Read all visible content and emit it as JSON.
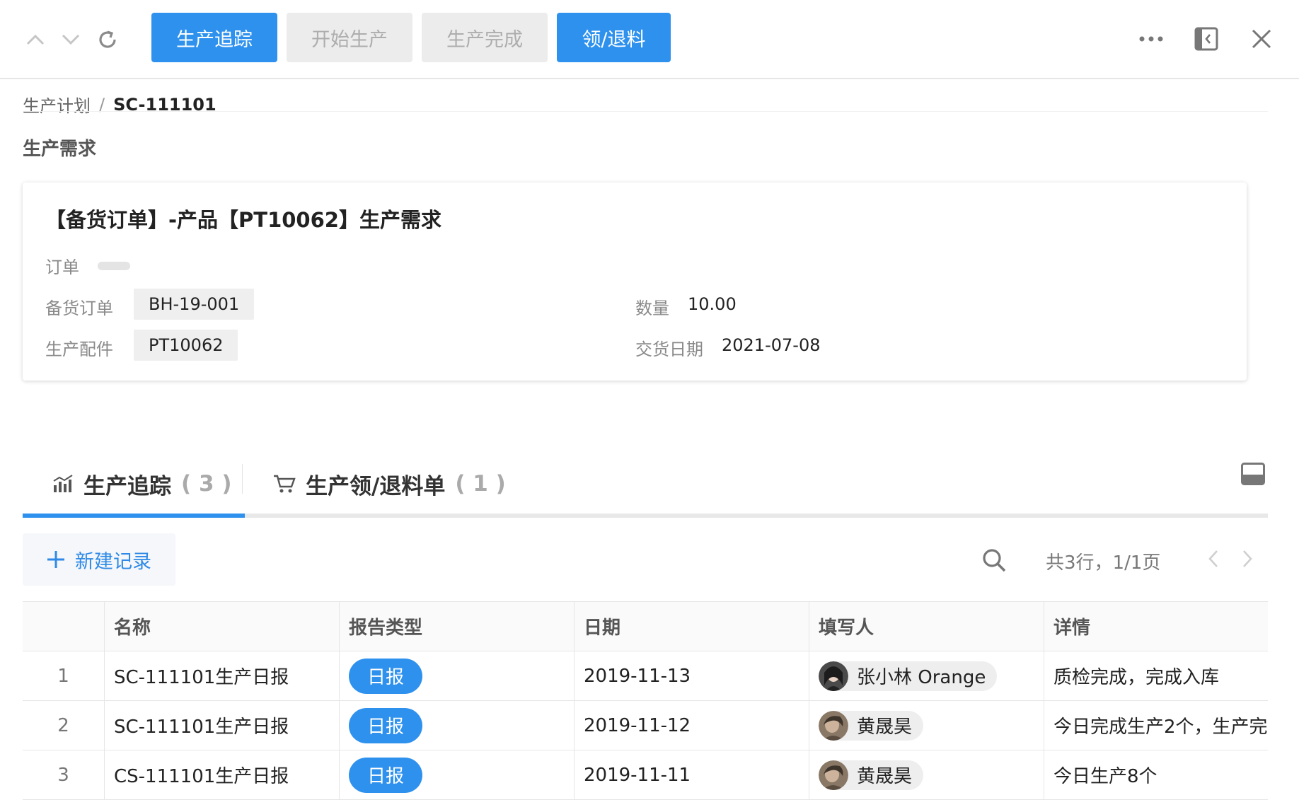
{
  "toolbar": {
    "buttons": [
      {
        "label": "生产追踪",
        "state": "primary"
      },
      {
        "label": "开始生产",
        "state": "disabled"
      },
      {
        "label": "生产完成",
        "state": "disabled"
      },
      {
        "label": "领/退料",
        "state": "primary"
      }
    ],
    "icons": [
      "chevron-up-icon",
      "chevron-down-icon",
      "refresh-icon",
      "more-icon",
      "collapse-panel-icon",
      "close-icon"
    ]
  },
  "breadcrumb": {
    "parent": "生产计划",
    "separator": "/",
    "current": "SC-111101"
  },
  "section_title": "生产需求",
  "card": {
    "title": "【备货订单】-产品【PT10062】生产需求",
    "order_label": "订单",
    "stock_order_label": "备货订单",
    "stock_order_value": "BH-19-001",
    "part_label": "生产配件",
    "part_value": "PT10062",
    "qty_label": "数量",
    "qty_value": "10.00",
    "delivery_label": "交货日期",
    "delivery_value": "2021-07-08"
  },
  "tabs": [
    {
      "label": "生产追踪",
      "count": "( 3 )",
      "icon": "chart-icon",
      "active": true
    },
    {
      "label": "生产领/退料单",
      "count": "( 1 )",
      "icon": "cart-icon",
      "active": false
    }
  ],
  "table_toolbar": {
    "new_label": "新建记录",
    "pager_text": "共3行，1/1页"
  },
  "table": {
    "headers": [
      "",
      "名称",
      "报告类型",
      "日期",
      "填写人",
      "详情"
    ],
    "rows": [
      {
        "index": "1",
        "name": "SC-111101生产日报",
        "type": "日报",
        "date": "2019-11-13",
        "user": "张小林 Orange",
        "detail": "质检完成，完成入库"
      },
      {
        "index": "2",
        "name": "SC-111101生产日报",
        "type": "日报",
        "date": "2019-11-12",
        "user": "黄晟昊",
        "detail": "今日完成生产2个，生产完"
      },
      {
        "index": "3",
        "name": "CS-111101生产日报",
        "type": "日报",
        "date": "2019-11-11",
        "user": "黄晟昊",
        "detail": "今日生产8个"
      }
    ]
  },
  "colors": {
    "primary": "#2e91ee",
    "disabled_bg": "#ececec",
    "disabled_text": "#adadad"
  }
}
